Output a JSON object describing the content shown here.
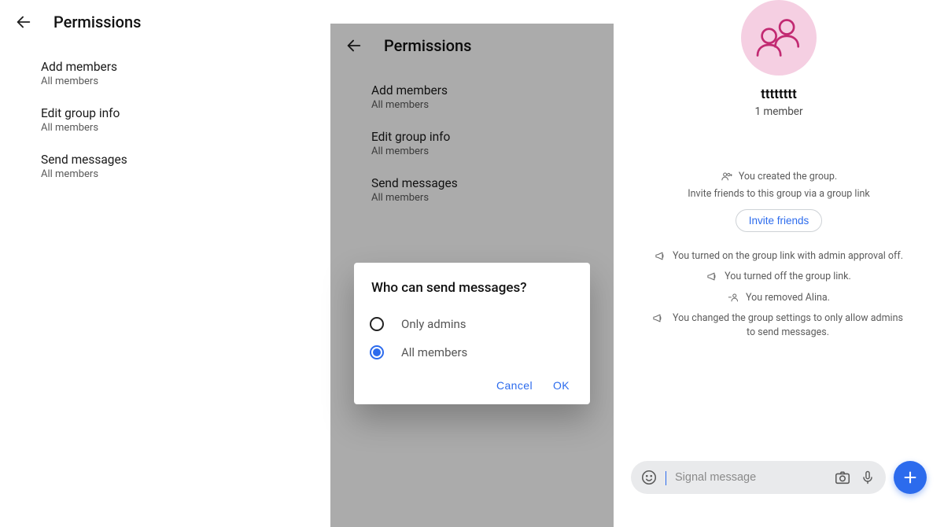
{
  "panels": {
    "permissions": {
      "title": "Permissions",
      "items": [
        {
          "title": "Add members",
          "value": "All members"
        },
        {
          "title": "Edit group info",
          "value": "All members"
        },
        {
          "title": "Send messages",
          "value": "All members"
        }
      ]
    },
    "dialog": {
      "title": "Who can send messages?",
      "options": [
        {
          "label": "Only admins",
          "selected": false
        },
        {
          "label": "All members",
          "selected": true
        }
      ],
      "cancel": "Cancel",
      "ok": "OK"
    },
    "chat": {
      "groupName": "tttttttt",
      "memberCount": "1 member",
      "inviteButton": "Invite friends",
      "system": {
        "created": "You created the group.",
        "inviteHint": "Invite friends to this group via a group link",
        "linkOn": "You turned on the group link with admin approval off.",
        "linkOff": "You turned off the group link.",
        "removed": "You removed Alina.",
        "settingsChanged": "You changed the group settings to only allow admins to send messages."
      },
      "composerPlaceholder": "Signal message"
    }
  }
}
